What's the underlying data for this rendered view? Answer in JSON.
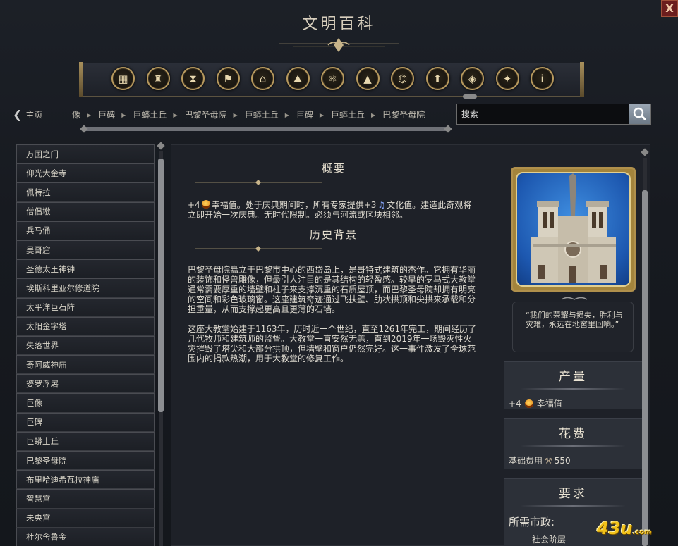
{
  "window": {
    "title": "文明百科",
    "close_label": "X"
  },
  "toolbar": {
    "categories": [
      {
        "name": "cat-general-icon",
        "glyph": "▦"
      },
      {
        "name": "cat-civics-icon",
        "glyph": "♜"
      },
      {
        "name": "cat-history-icon",
        "glyph": "⧗"
      },
      {
        "name": "cat-leaders-icon",
        "glyph": "⚑"
      },
      {
        "name": "cat-districts-icon",
        "glyph": "⌂"
      },
      {
        "name": "cat-terrain-icon",
        "glyph": "⛰"
      },
      {
        "name": "cat-technology-icon",
        "glyph": "⚛"
      },
      {
        "name": "cat-features-icon",
        "glyph": "▲"
      },
      {
        "name": "cat-buildings-icon",
        "glyph": "⌬"
      },
      {
        "name": "cat-units-icon",
        "glyph": "⬆"
      },
      {
        "name": "cat-wonders-icon",
        "glyph": "◈"
      },
      {
        "name": "cat-religion-icon",
        "glyph": "✦"
      },
      {
        "name": "cat-info-icon",
        "glyph": "i"
      }
    ]
  },
  "nav": {
    "home_label": "主页",
    "breadcrumb": [
      "巨像",
      "巨碑",
      "巨蟒土丘",
      "巴黎圣母院",
      "巨蟒土丘",
      "巨碑",
      "巨蟒土丘",
      "巴黎圣母院"
    ],
    "breadcrumb_first": "巨像"
  },
  "search": {
    "placeholder": "搜索"
  },
  "list": {
    "items": [
      "万国之门",
      "仰光大金寺",
      "佩特拉",
      "僧侣墩",
      "兵马俑",
      "吴哥窟",
      "圣德太王神钟",
      "埃斯科里亚尔修道院",
      "太平洋巨石阵",
      "太阳金字塔",
      "失落世界",
      "奇阿威神庙",
      "婆罗浮屠",
      "巨像",
      "巨碑",
      "巨蟒土丘",
      "巴黎圣母院",
      "布里哈迪希瓦拉神庙",
      "智慧宫",
      "未央宫",
      "杜尔舍鲁金"
    ]
  },
  "article": {
    "overview_title": "概要",
    "overview_prefix": "+4",
    "overview_part1": "幸福值。处于庆典期间时，所有专家提供+3",
    "overview_part2": "文化值。建造此奇观将立即开始一次庆典。无时代限制。必须与河流或区块相邻。",
    "history_title": "历史背景",
    "history_p1": "巴黎圣母院矗立于巴黎市中心的西岱岛上，是哥特式建筑的杰作。它拥有华丽的装饰和怪兽雕像，但最引人注目的是其结构的轻盈感。较早的罗马式大教堂通常需要厚重的墙壁和柱子来支撑沉重的石质屋顶，而巴黎圣母院却拥有明亮的空间和彩色玻璃窗。这座建筑奇迹通过飞扶壁、肋状拱顶和尖拱来承载和分担重量，从而支撑起更高且更薄的石墙。",
    "history_p2": "这座大教堂始建于1163年，历时近一个世纪，直至1261年完工，期间经历了几代牧师和建筑师的监督。大教堂一直安然无恙，直到2019年一场毁灭性火灾摧毁了塔尖和大部分拱顶，但墙壁和窗户仍然完好。这一事件激发了全球范围内的捐款热潮，用于大教堂的修复工作。"
  },
  "sidebar": {
    "quote": "“我们的荣耀与损失，胜利与灾难，永远在地窖里回响。”",
    "yield_title": "产量",
    "yield_value": "+4",
    "yield_label": "幸福值",
    "cost_title": "花费",
    "cost_label": "基础费用",
    "cost_value": "550",
    "req_title": "要求",
    "req_label": "所需市政:",
    "req_value": "社会阶层"
  },
  "watermark": {
    "text": "43u",
    "suffix": ".com"
  },
  "colors": {
    "gold": "#b89a5e",
    "panel": "#2c3038",
    "background": "#171a20",
    "happy": "#f0a020",
    "culture": "#8aa8ff"
  }
}
